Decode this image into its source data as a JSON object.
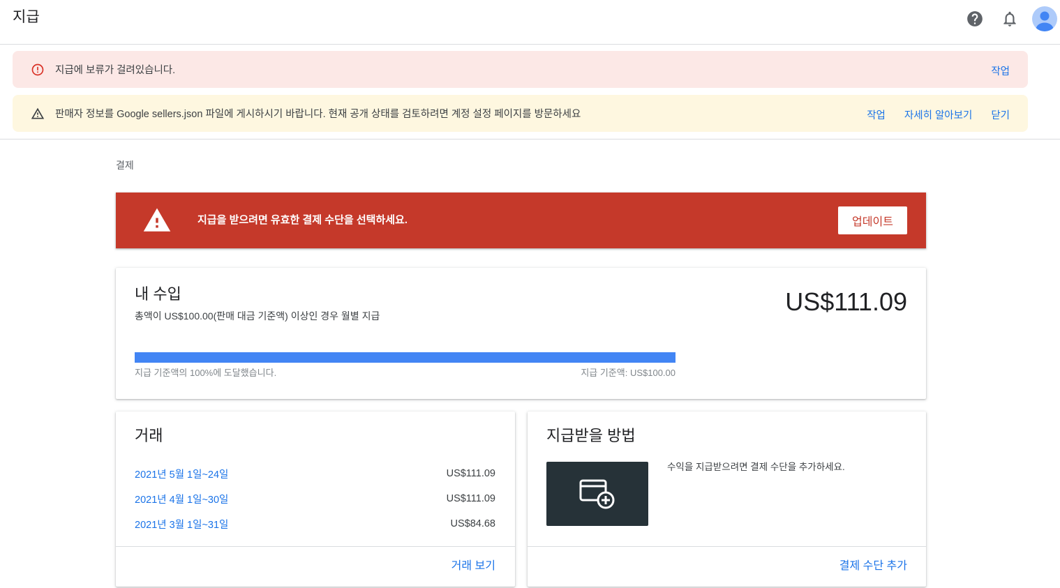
{
  "header": {
    "title": "지급",
    "icons": {
      "help": "help-icon",
      "notifications": "notifications-icon",
      "account": "account-avatar-icon"
    }
  },
  "alerts": [
    {
      "icon": "error-outline-icon",
      "message": "지급에 보류가 걸려있습니다.",
      "actions": [
        "작업"
      ]
    },
    {
      "icon": "warning-outline-icon",
      "message": "판매자 정보를 Google sellers.json 파일에 게시하시기 바랍니다. 현재 공개 상태를 검토하려면 계정 설정 페이지를 방문하세요",
      "actions": [
        "작업",
        "자세히 알아보기",
        "닫기"
      ]
    }
  ],
  "section_label": "결제",
  "payment_banner": {
    "icon": "warning-icon",
    "message": "지급을 받으려면 유효한 결제 수단을 선택하세요.",
    "button_label": "업데이트"
  },
  "earnings": {
    "title": "내 수입",
    "subtitle": "총액이 US$100.00(판매 대금 기준액) 이상인 경우 월별 지급",
    "amount": "US$111.09",
    "progress_percent": 100,
    "progress_label": "지급 기준액의 100%에 도달했습니다.",
    "threshold_label": "지급 기준액: US$100.00"
  },
  "transactions": {
    "title": "거래",
    "rows": [
      {
        "period": "2021년 5월 1일~24일",
        "amount": "US$111.09"
      },
      {
        "period": "2021년 4월 1일~30일",
        "amount": "US$111.09"
      },
      {
        "period": "2021년 3월 1일~31일",
        "amount": "US$84.68"
      }
    ],
    "view_link": "거래 보기"
  },
  "payment_method": {
    "title": "지급받을 방법",
    "icon": "add-card-icon",
    "description": "수익을 지급받으려면 결제 수단을 추가하세요.",
    "add_link": "결제 수단 추가"
  },
  "colors": {
    "link": "#1a73e8",
    "error_alert_bg": "#fce8e6",
    "warning_alert_bg": "#fef7e0",
    "error_banner_bg": "#c5392a",
    "progress_fill": "#4285f4",
    "payment_tile_bg": "#263238"
  }
}
